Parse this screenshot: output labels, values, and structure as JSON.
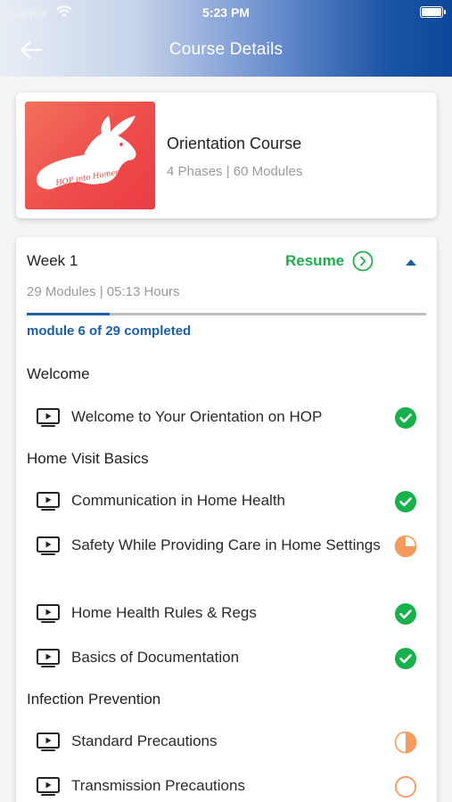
{
  "status_bar": {
    "carrier": "Carrier",
    "time": "5:23 PM"
  },
  "header": {
    "title": "Course Details",
    "back_icon": "arrow-left-icon"
  },
  "course": {
    "title": "Orientation Course",
    "subtitle": "4 Phases | 60 Modules",
    "thumbnail_text": "HOP into Homecare!"
  },
  "week": {
    "title": "Week 1",
    "resume_label": "Resume",
    "meta": "29 Modules | 05:13 Hours",
    "progress_text": "module 6 of 29 completed",
    "progress_fraction": 0.207
  },
  "sections": [
    {
      "title": "Welcome",
      "modules": [
        {
          "label": "Welcome to Your Orientation on HOP",
          "status": "completed"
        }
      ]
    },
    {
      "title": "Home Visit Basics",
      "modules": [
        {
          "label": "Communication in Home Health",
          "status": "completed"
        },
        {
          "label": "Safety While Providing Care in Home Settings",
          "status": "in-progress-quarter"
        },
        {
          "label": "Home Health Rules & Regs",
          "status": "completed"
        },
        {
          "label": "Basics of Documentation",
          "status": "completed"
        }
      ]
    },
    {
      "title": "Infection Prevention",
      "modules": [
        {
          "label": "Standard Precautions",
          "status": "in-progress-half"
        },
        {
          "label": "Transmission Precautions",
          "status": "not-started"
        }
      ]
    }
  ],
  "colors": {
    "completed": "#17b14b",
    "progress": "#f39a5c",
    "accent": "#1b5fa8",
    "resume": "#1fae4f"
  }
}
